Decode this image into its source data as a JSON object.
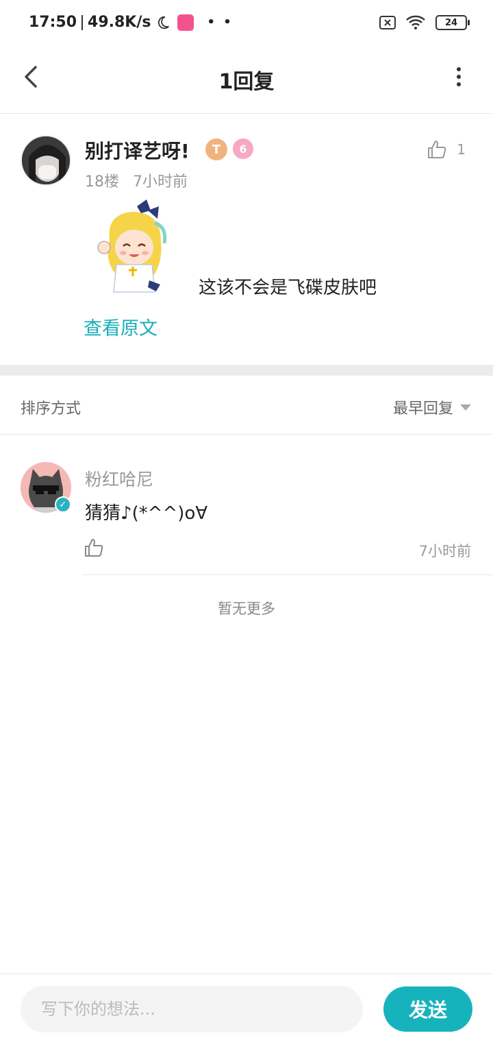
{
  "status_bar": {
    "time": "17:50",
    "net_speed": "49.8K/s",
    "battery": "24"
  },
  "header": {
    "title": "1回复"
  },
  "main_comment": {
    "username": "别打译艺呀!",
    "level_badge": "T",
    "like_count": "1",
    "floor": "18楼",
    "time": "7小时前",
    "text": "这该不会是飞碟皮肤吧",
    "view_original": "查看原文"
  },
  "sort": {
    "label": "排序方式",
    "selected": "最早回复"
  },
  "replies": [
    {
      "username": "粉红哈尼",
      "text": "猜猜♪(*^^)o∀",
      "time": "7小时前"
    }
  ],
  "footer_text": "暂无更多",
  "composer": {
    "placeholder": "写下你的想法...",
    "send_label": "发送"
  },
  "colors": {
    "accent": "#17b3bd",
    "link": "#17aeb8"
  }
}
